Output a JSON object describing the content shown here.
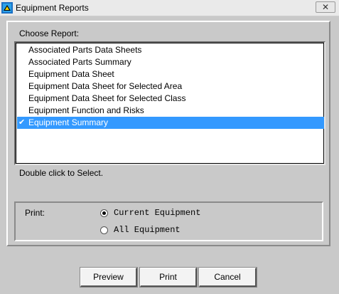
{
  "window": {
    "title": "Equipment Reports",
    "close_glyph": "✕"
  },
  "report": {
    "label": "Choose Report:",
    "items": [
      "Associated Parts Data Sheets",
      "Associated Parts Summary",
      "Equipment Data Sheet",
      "Equipment Data Sheet for Selected Area",
      "Equipment Data Sheet for Selected Class",
      "Equipment Function and Risks",
      "Equipment Summary"
    ],
    "selected_index": 6,
    "check_glyph": "✔",
    "hint": "Double click to Select."
  },
  "print": {
    "label": "Print:",
    "options": [
      "Current Equipment",
      "All Equipment"
    ],
    "selected_index": 0
  },
  "buttons": {
    "preview": "Preview",
    "print": "Print",
    "cancel": "Cancel"
  },
  "colors": {
    "selection": "#3399ff",
    "dialog_bg": "#c9c9c9"
  }
}
